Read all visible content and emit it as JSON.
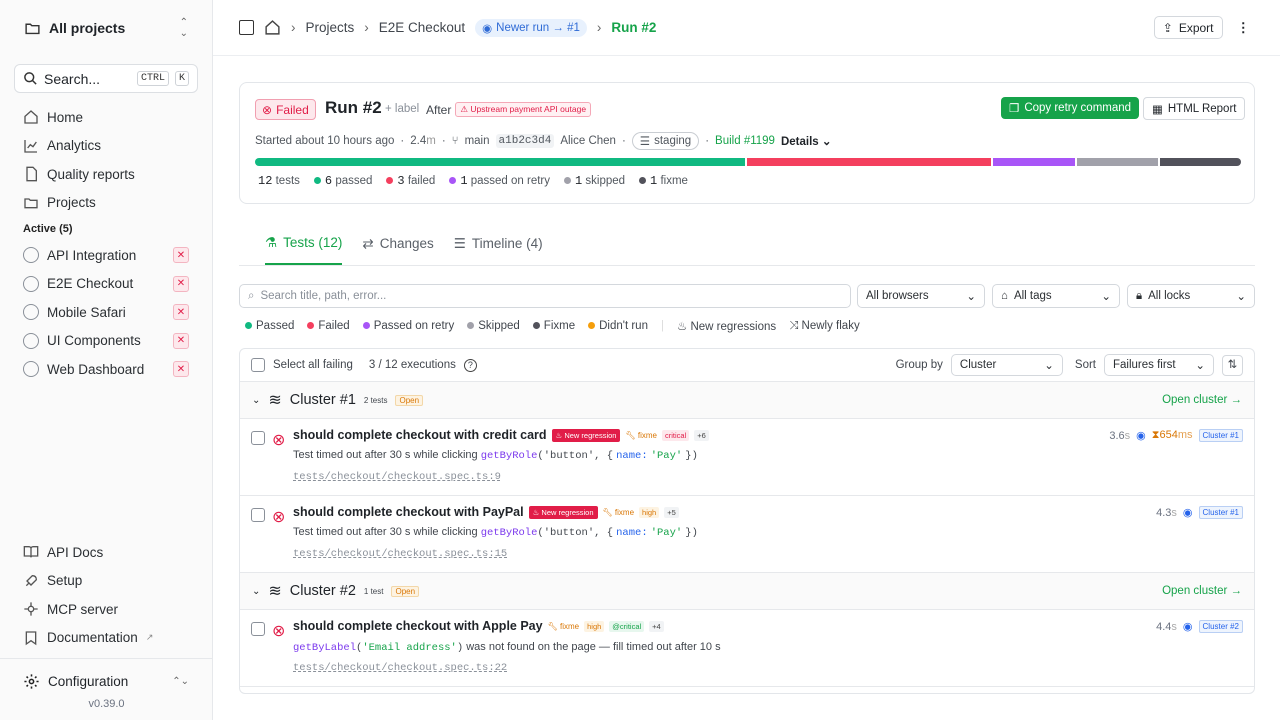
{
  "sidebar": {
    "project_switcher": "All projects",
    "search": {
      "placeholder": "Search...",
      "k1": "CTRL",
      "k2": "K"
    },
    "nav": [
      {
        "label": "Home",
        "icon": "home-icon"
      },
      {
        "label": "Analytics",
        "icon": "chart-icon"
      },
      {
        "label": "Quality reports",
        "icon": "file-icon"
      },
      {
        "label": "Projects",
        "icon": "folder-icon"
      }
    ],
    "active_label": "Active (5)",
    "projects": [
      "API Integration",
      "E2E Checkout",
      "Mobile Safari",
      "UI Components",
      "Web Dashboard"
    ],
    "bottom": [
      {
        "label": "API Docs"
      },
      {
        "label": "Setup"
      },
      {
        "label": "MCP server"
      },
      {
        "label": "Documentation"
      }
    ],
    "config": "Configuration",
    "version": "v0.39.0"
  },
  "topbar": {
    "projects": "Projects",
    "project": "E2E Checkout",
    "newer": "Newer run → #1",
    "run": "Run #2",
    "export": "Export"
  },
  "run": {
    "status": "Failed",
    "title": "Run #2",
    "label": "+ label",
    "after": "After",
    "after_tag": "Upstream payment API outage",
    "copy": "Copy retry command",
    "report": "HTML Report",
    "started": "Started about 10 hours ago",
    "duration": "2.4",
    "duration_unit": "m",
    "branch": "main",
    "commit": "a1b2c3d4",
    "author": "Alice Chen",
    "env": "staging",
    "build": "Build #1199",
    "details": "Details",
    "bar": [
      {
        "share": 0.5,
        "color": "#10b981"
      },
      {
        "share": 0.25,
        "color": "#f43f5e"
      },
      {
        "share": 0.083,
        "color": "#a855f7"
      },
      {
        "share": 0.083,
        "color": "#a1a1aa"
      },
      {
        "share": 0.083,
        "color": "#52525b"
      }
    ],
    "stats": {
      "tests_n": "12",
      "tests": "tests",
      "passed_n": "6",
      "passed": "passed",
      "failed_n": "3",
      "failed": "failed",
      "retry_n": "1",
      "retry": "passed on retry",
      "skipped_n": "1",
      "skipped": "skipped",
      "fixme_n": "1",
      "fixme": "fixme"
    }
  },
  "tabs": [
    {
      "label": "Tests (12)"
    },
    {
      "label": "Changes"
    },
    {
      "label": "Timeline (4)"
    }
  ],
  "filters": {
    "search_placeholder": "Search title, path, error...",
    "browsers": "All browsers",
    "tags": "All tags",
    "locks": "All locks"
  },
  "legend": {
    "passed": "Passed",
    "failed": "Failed",
    "retry": "Passed on retry",
    "skipped": "Skipped",
    "fixme": "Fixme",
    "didnt": "Didn't run",
    "newreg": "New regressions",
    "flaky": "Newly flaky"
  },
  "listhead": {
    "select": "Select all failing",
    "count": "3 / 12 executions",
    "groupby": "Group by",
    "group": "Cluster",
    "sort": "Sort",
    "sortval": "Failures first"
  },
  "clusters": [
    {
      "name": "Cluster #1",
      "count": "2 tests",
      "open": "Open",
      "link": "Open cluster →"
    },
    {
      "name": "Cluster #2",
      "count": "1 test",
      "open": "Open",
      "link": "Open cluster →"
    }
  ],
  "tests": [
    {
      "title": "should complete checkout with credit card",
      "regress": "New regression",
      "fixme": "fixme",
      "tag": "critical",
      "more": "+6",
      "msg1": "Test timed out after 30 s while clicking",
      "fn": "getByRole",
      "arg": "('button', {",
      "key": "name:",
      "val": "'Pay'",
      "end": "})",
      "path": "tests/checkout/checkout.spec.ts:9",
      "dur": "3.6",
      "unit": "s",
      "slow": "654",
      "slow_unit": "ms",
      "cluster": "Cluster #1"
    },
    {
      "title": "should complete checkout with PayPal",
      "regress": "New regression",
      "fixme": "fixme",
      "tag": "high",
      "more": "+5",
      "msg1": "Test timed out after 30 s while clicking",
      "fn": "getByRole",
      "arg": "('button', {",
      "key": "name:",
      "val": "'Pay'",
      "end": "})",
      "path": "tests/checkout/checkout.spec.ts:15",
      "dur": "4.3",
      "unit": "s",
      "cluster": "Cluster #1"
    },
    {
      "title": "should complete checkout with Apple Pay",
      "fixme": "fixme",
      "tag": "high",
      "tag2": "@critical",
      "more": "+4",
      "fn": "getByLabel",
      "arg": "'Email address'",
      "msg2": "was not found on the page — fill timed out after 10 s",
      "path": "tests/checkout/checkout.spec.ts:22",
      "dur": "4.4",
      "unit": "s",
      "cluster": "Cluster #2"
    }
  ]
}
